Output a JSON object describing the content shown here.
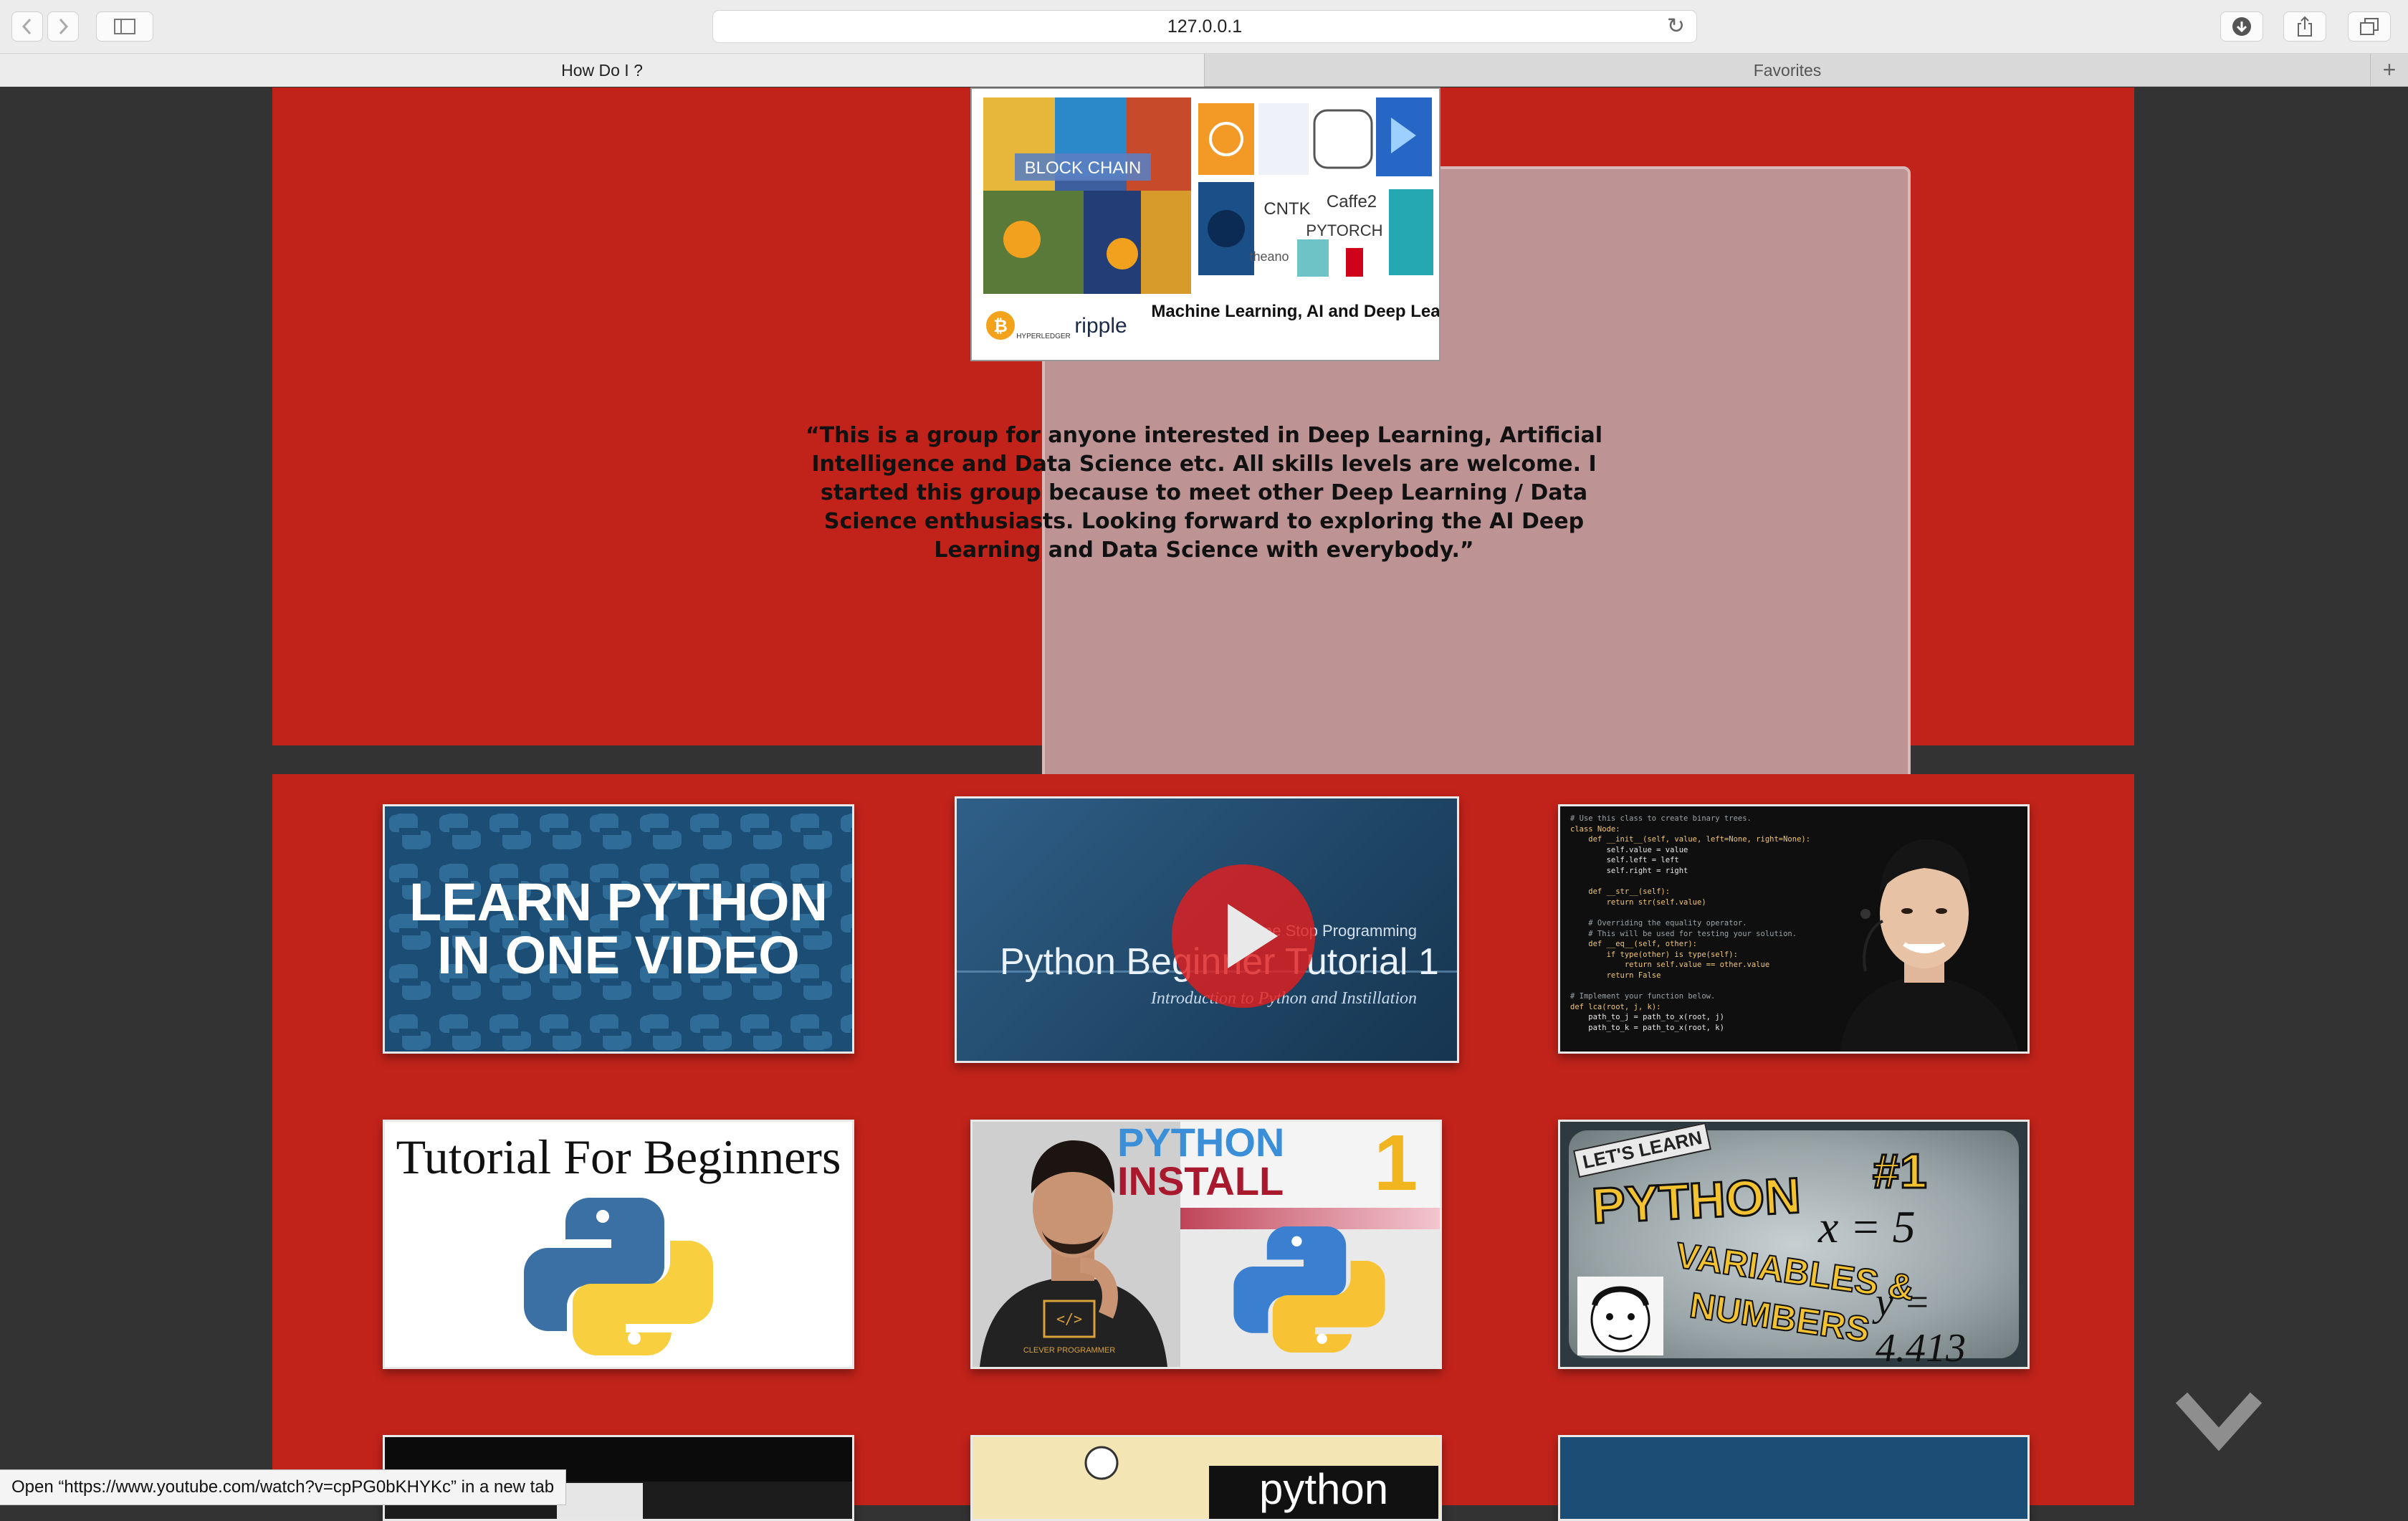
{
  "browser": {
    "url": "127.0.0.1",
    "tabs": [
      {
        "label": "How Do I ?",
        "active": true
      },
      {
        "label": "Favorites",
        "active": false
      }
    ],
    "status_text": "Open “https://www.youtube.com/watch?v=cpPG0bKHYKc” in a new tab"
  },
  "group": {
    "collage_captions": {
      "blockchain": "BLOCK CHAIN",
      "ripple": "ripple",
      "hyperledger": "HYPERLEDGER",
      "ml": "Machine Learning, AI and Deep Learning",
      "cntk": "CNTK",
      "caffe": "Caffe2",
      "pytorch": "PYTORCH",
      "theano": "theano"
    },
    "quote": "“This is a group for anyone interested in Deep Learning, Artificial Intelligence and Data Science etc. All skills levels are welcome. I started this group because to meet other Deep Learning / Data Science enthusiasts. Looking forward to exploring the AI Deep Learning and Data Science with everybody.”"
  },
  "videos": [
    {
      "title_line1": "LEARN PYTHON",
      "title_line2": "IN ONE VIDEO"
    },
    {
      "title": "Python Beginner Tutorial 1",
      "subtitle": "Introduction to Python and Instillation",
      "channel": "One Stop Programming"
    },
    {
      "code_lines": [
        "# Use this class to create binary trees.",
        "class Node:",
        "    def __init__(self, value, left=None, right=None):",
        "        self.value = value",
        "        self.left = left",
        "        self.right = right",
        "",
        "    def __str__(self):",
        "        return str(self.value)",
        "",
        "    # Overriding the equality operator.",
        "    # This will be used for testing your solution.",
        "    def __eq__(self, other):",
        "        if type(other) is type(self):",
        "            return self.value == other.value",
        "        return False",
        "",
        "# Implement your function below.",
        "def lca(root, j, k):",
        "    path_to_j = path_to_x(root, j)",
        "    path_to_k = path_to_x(root, k)"
      ]
    },
    {
      "title": "Tutorial For Beginners"
    },
    {
      "title_line1": "PYTHON",
      "title_line2": "INSTALL",
      "number": "1",
      "shirt": "CLEVER PROGRAMMER"
    },
    {
      "tag": "LET'S LEARN",
      "title": "PYTHON",
      "subtitle_line1": "VARIABLES &",
      "subtitle_line2": "NUMBERS",
      "number": "#1",
      "math1": "x = 5",
      "math2": "y = 4.413"
    },
    {
      "label": ""
    },
    {
      "label": "python"
    },
    {
      "label": ""
    }
  ],
  "colors": {
    "page_bg": "#333333",
    "section_red": "#c1231a",
    "card_pink": "#be9394"
  },
  "icons": {
    "back": "chevron-left-icon",
    "forward": "chevron-right-icon",
    "sidebar": "sidebar-icon",
    "reload": "reload-icon",
    "download": "download-icon",
    "share": "share-icon",
    "tabs": "tabs-overview-icon",
    "scroll_down": "chevron-down-icon"
  }
}
